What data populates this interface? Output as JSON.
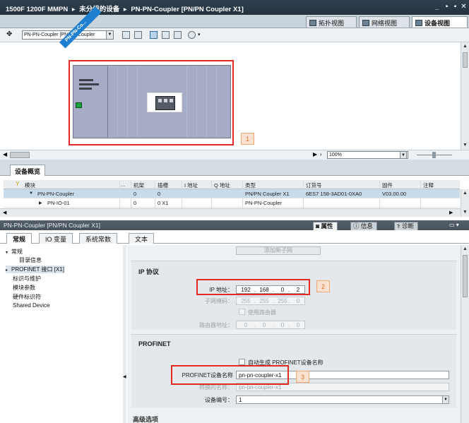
{
  "window": {
    "title_segments": [
      "1500F 1200F MMPN",
      "▸",
      "未分组的设备",
      "▸",
      "PN-PN-Coupler [PN/PN Coupler X1]"
    ],
    "controls": [
      "_",
      "▪",
      "▪",
      "✕"
    ]
  },
  "view_tabs": [
    {
      "label": "拓扑视图",
      "active": false
    },
    {
      "label": "网络视图",
      "active": false
    },
    {
      "label": "设备视图",
      "active": true
    }
  ],
  "toolbar": {
    "device_select": "PN-PN-Coupler [PN/PN Coupler"
  },
  "canvas": {
    "device_label": "PN-PN-Co...",
    "callout_1": "1",
    "zoom": "100%"
  },
  "overview": {
    "tab_label": "设备概览",
    "columns": [
      "模块",
      "...",
      "机架",
      "插槽",
      "I 地址",
      "Q 地址",
      "类型",
      "订货号",
      "固件",
      "注释"
    ],
    "rows": [
      {
        "module": "PN-PN-Coupler",
        "rack": "0",
        "slot": "0",
        "i_addr": "",
        "q_addr": "",
        "type": "PN/PN Coupler X1",
        "order": "6ES7 158-3AD01-0XA0",
        "firmware": "V03.00.00",
        "selected": true
      },
      {
        "module": "PN-IO-01",
        "rack": "0",
        "slot": "0 X1",
        "i_addr": "",
        "q_addr": "",
        "type": "PN-PN-Coupler",
        "order": "",
        "firmware": "",
        "selected": false
      }
    ]
  },
  "properties": {
    "header_title": "PN-PN-Coupler [PN/PN Coupler X1]",
    "header_tabs": [
      {
        "label": "属性",
        "active": true
      },
      {
        "label": "信息",
        "active": false
      },
      {
        "label": "诊断",
        "active": false
      }
    ],
    "sub_tabs": [
      {
        "label": "常规",
        "active": true
      },
      {
        "label": "IO 变量",
        "active": false
      },
      {
        "label": "系统常数",
        "active": false
      },
      {
        "label": "文本",
        "active": false
      }
    ],
    "nav": [
      {
        "label": "常规",
        "indent": 0,
        "twisty": "▾"
      },
      {
        "label": "目录信息",
        "indent": 2,
        "twisty": ""
      },
      {
        "label": "PROFINET 接口 [X1]",
        "indent": 0,
        "twisty": "▸"
      },
      {
        "label": "标识与维护",
        "indent": 0,
        "twisty": ""
      },
      {
        "label": "模块参数",
        "indent": 0,
        "twisty": ""
      },
      {
        "label": "硬件标识符",
        "indent": 0,
        "twisty": ""
      },
      {
        "label": "Shared Device",
        "indent": 0,
        "twisty": ""
      }
    ],
    "add_subnet_button": "添加新子网",
    "ip_section": {
      "title": "IP 协议",
      "ip_label": "IP 地址：",
      "ip_value": [
        "192",
        "168",
        "0",
        "2"
      ],
      "mask_label": "子网掩码：",
      "mask_value": [
        "255",
        "255",
        "255",
        "0"
      ],
      "use_router_label": "使用路由器",
      "router_label": "路由器地址：",
      "router_value": [
        "0",
        "0",
        "0",
        "0"
      ],
      "callout_2": "2"
    },
    "profinet_section": {
      "title": "PROFINET",
      "auto_name_label": "自动生成 PROFINET设备名称",
      "device_name_label": "PROFINET设备名称",
      "device_name_value": "pn-pn-coupler-x1",
      "converted_label": "转换的名称：",
      "converted_value": "pn-pn-coupler-x1",
      "device_number_label": "设备编号：",
      "device_number_value": "1",
      "callout_3": "3"
    },
    "advanced_label": "高级选项"
  }
}
